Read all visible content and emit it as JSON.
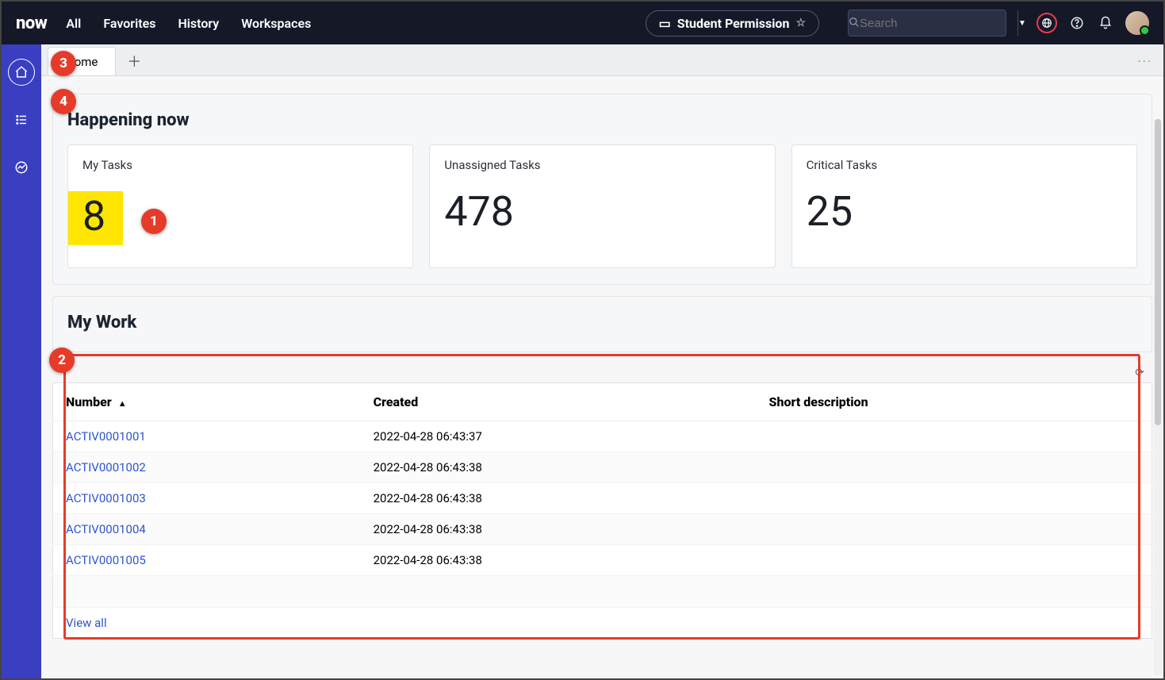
{
  "topnav": {
    "logo": "now",
    "menu": [
      "All",
      "Favorites",
      "History",
      "Workspaces"
    ],
    "pill_label": "Student Permission",
    "search_placeholder": "Search"
  },
  "tabs": {
    "home": "Home"
  },
  "happening": {
    "title": "Happening now",
    "cards": [
      {
        "label": "My Tasks",
        "value": "8",
        "highlight": true
      },
      {
        "label": "Unassigned Tasks",
        "value": "478",
        "highlight": false
      },
      {
        "label": "Critical Tasks",
        "value": "25",
        "highlight": false
      }
    ]
  },
  "mywork": {
    "title": "My Work",
    "columns": {
      "number": "Number",
      "created": "Created",
      "short_desc": "Short description"
    },
    "rows": [
      {
        "number": "ACTIV0001001",
        "created": "2022-04-28 06:43:37",
        "short_desc": ""
      },
      {
        "number": "ACTIV0001002",
        "created": "2022-04-28 06:43:38",
        "short_desc": ""
      },
      {
        "number": "ACTIV0001003",
        "created": "2022-04-28 06:43:38",
        "short_desc": ""
      },
      {
        "number": "ACTIV0001004",
        "created": "2022-04-28 06:43:38",
        "short_desc": ""
      },
      {
        "number": "ACTIV0001005",
        "created": "2022-04-28 06:43:38",
        "short_desc": ""
      }
    ],
    "view_all": "View all"
  },
  "annotations": {
    "a1": "1",
    "a2": "2",
    "a3": "3",
    "a4": "4"
  }
}
